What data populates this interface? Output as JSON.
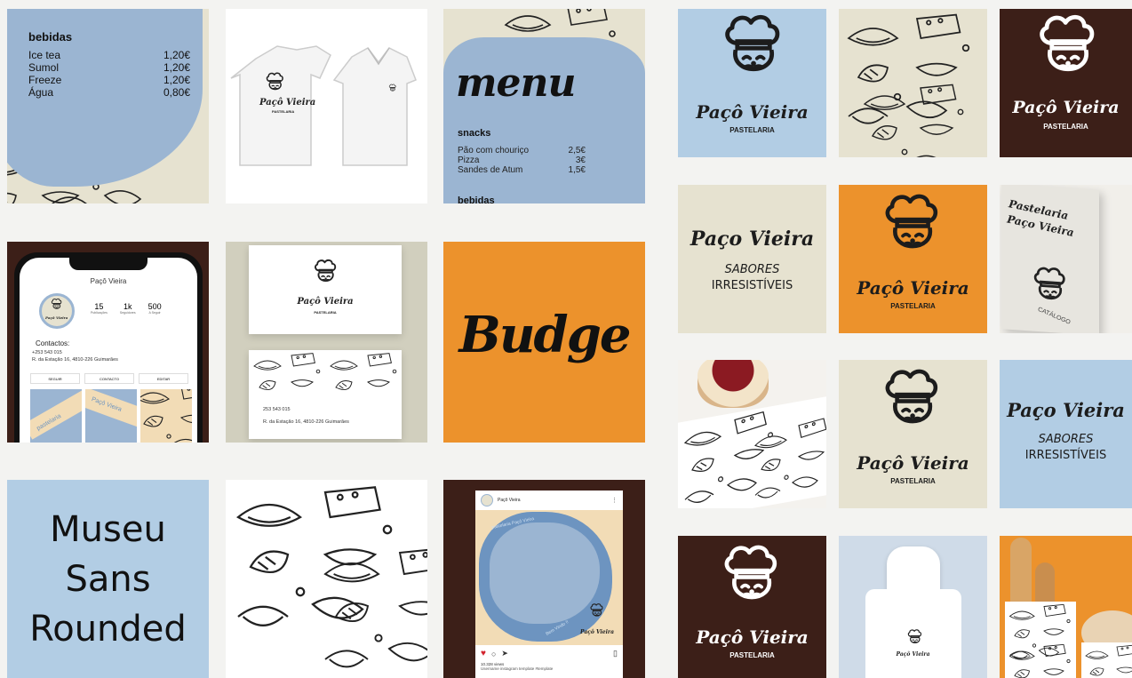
{
  "colors": {
    "blue": "#9bb5d2",
    "lightblue": "#b2cde4",
    "cream": "#e6e2d0",
    "orange": "#ec922c",
    "brown": "#3c1f18",
    "ink": "#1c1c1c",
    "white": "#ffffff"
  },
  "left": {
    "drinks_menu": {
      "heading": "bebidas",
      "items": [
        {
          "name": "Ice tea",
          "price": "1,20€"
        },
        {
          "name": "Sumol",
          "price": "1,20€"
        },
        {
          "name": "Freeze",
          "price": "1,20€"
        },
        {
          "name": "Água",
          "price": "0,80€"
        }
      ]
    },
    "polo": {
      "brand": "Paçô Vieira",
      "sub": "PASTELARIA"
    },
    "menu": {
      "title": "menu",
      "section": "snacks",
      "items": [
        {
          "name": "Pão com chouriço",
          "price": "2,5€"
        },
        {
          "name": "Pizza",
          "price": "3€"
        },
        {
          "name": "Sandes de Atum",
          "price": "1,5€"
        }
      ],
      "next_section": "bebidas"
    },
    "phone": {
      "profile_name": "Paçô Vieira",
      "stats": [
        {
          "value": "15",
          "label": "Publicações"
        },
        {
          "value": "1k",
          "label": "Seguidores"
        },
        {
          "value": "500",
          "label": "A Seguir"
        }
      ],
      "contacts_title": "Contactos:",
      "phone": "+253 543 015",
      "address": "R. da Estação 16, 4810-226 Guimarães",
      "buttons": [
        "SEGUIR",
        "CONTACTO",
        "EDITAR"
      ],
      "avatar_brand": "Paçô Vieira",
      "avatar_sub": "PASTELARIA",
      "feed_text": "Paçô Vieira",
      "feed_text2": "pastelaria"
    },
    "cards": {
      "brand": "Paçô Vieira",
      "sub": "PASTELARIA",
      "phone": "253 543 015",
      "address": "R. da Estação 16, 4810-226 Guimarães"
    },
    "budge": {
      "text": "Budge"
    },
    "museo": {
      "line1": "Museu",
      "line2": "Sans",
      "line3": "Rounded"
    },
    "insta_post": {
      "account": "Paçô Vieira",
      "ring_text": "pastelaria Paçô Vieira",
      "ring_text2": "Bem Vindo !!",
      "brand": "Paçô Vieira",
      "sub": "PASTELARIA",
      "views": "10.328 views",
      "caption": "Username instagram template #template"
    }
  },
  "right": {
    "logo_blue": {
      "brand": "Paçô Vieira",
      "sub": "PASTELARIA"
    },
    "logo_brown": {
      "brand": "Paçô Vieira",
      "sub": "PASTELARIA"
    },
    "slogan_cream": {
      "brand": "Paço Vieira",
      "line1": "SABORES",
      "line2": "IRRESISTÍVEIS"
    },
    "logo_orange": {
      "brand": "Paçô Vieira",
      "sub": "PASTELARIA"
    },
    "catalog": {
      "brand1": "Pastelaria",
      "brand2": "Paço Vieira",
      "label": "CATÁLOGO"
    },
    "logo_cream": {
      "brand": "Paçô Vieira",
      "sub": "PASTELARIA"
    },
    "slogan_blue": {
      "brand": "Paço Vieira",
      "line1": "SABORES",
      "line2": "IRRESISTÍVEIS"
    },
    "logo_brown2": {
      "brand": "Paçô Vieira",
      "sub": "PASTELARIA"
    },
    "apron": {
      "brand": "Paçô Vieira",
      "sub": "PASTELARIA"
    }
  }
}
